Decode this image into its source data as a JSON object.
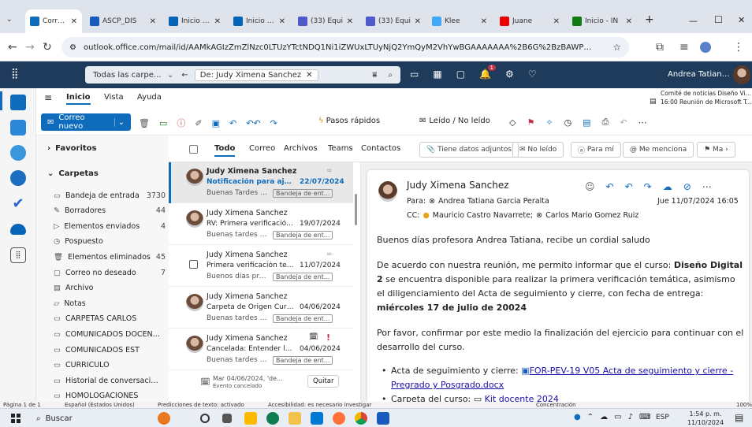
{
  "browser": {
    "tabs": [
      {
        "label": "Correo: Ai",
        "active": true,
        "color": "#0f6cbd"
      },
      {
        "label": "ASCP_DIS",
        "color": "#185abd"
      },
      {
        "label": "Inicio - O",
        "color": "#0364b8"
      },
      {
        "label": "Inicio - O",
        "color": "#0364b8"
      },
      {
        "label": "(33) Equi",
        "color": "#5059c9"
      },
      {
        "label": "(33) Equi",
        "color": "#5059c9"
      },
      {
        "label": "Klee",
        "color": "#3fa9f5"
      },
      {
        "label": "Juane",
        "color": "#e00"
      },
      {
        "label": "Inicio - IN",
        "color": "#107c10"
      }
    ],
    "new_tab": "+",
    "minimize": "—",
    "maximize": "☐",
    "close": "✕",
    "url": "outlook.office.com/mail/id/AAMkAGIzZmZlNzc0LTUzYTctNDQ1Ni1iZWUxLTUyNjQ2YmQyM2VhYwBGAAAAAAA%2B6G%2BzBAWPSKhEFeCziPrkBwC2ZD24..."
  },
  "outlook": {
    "search_scope": "Todas las carpe...",
    "search_chip": "De: Judy Ximena Sanchez",
    "user_name": "Andrea Tatiana Ga...",
    "notif_count": "1"
  },
  "ribbon": {
    "tabs": [
      "Inicio",
      "Vista",
      "Ayuda"
    ],
    "new_mail": "Correo nuevo",
    "quick_steps": "Pasos rápidos",
    "read_unread": "Leído / No leído",
    "reminder_title": "Comité de noticias Diseño Vis...",
    "reminder_time": "16:00 Reunión de Microsoft Tea..."
  },
  "folders": {
    "favorites": "Favoritos",
    "folders_header": "Carpetas",
    "items": [
      {
        "label": "Bandeja de entrada",
        "count": "3730"
      },
      {
        "label": "Borradores",
        "count": "44"
      },
      {
        "label": "Elementos enviados",
        "count": "4"
      },
      {
        "label": "Pospuesto",
        "count": ""
      },
      {
        "label": "Elementos eliminados",
        "count": "45"
      },
      {
        "label": "Correo no deseado",
        "count": "7"
      },
      {
        "label": "Archivo",
        "count": ""
      },
      {
        "label": "Notas",
        "count": ""
      },
      {
        "label": "CARPETAS CARLOS",
        "count": ""
      },
      {
        "label": "COMUNICADOS DOCENTES",
        "count": ""
      },
      {
        "label": "COMUNICADOS EST",
        "count": ""
      },
      {
        "label": "CURRICULO",
        "count": ""
      },
      {
        "label": "Historial de conversaciones",
        "count": ""
      },
      {
        "label": "HOMOLOGACIONES",
        "count": ""
      }
    ]
  },
  "filters": {
    "tabs": [
      "Todo",
      "Correo",
      "Archivos",
      "Teams",
      "Contactos"
    ],
    "buttons": [
      "Tiene datos adjuntos",
      "No leído",
      "Para mí",
      "Me menciona",
      "Ma"
    ]
  },
  "messages": [
    {
      "sender": "Judy Ximena Sanchez",
      "subject": "Notificación para ajuste...",
      "date": "22/07/2024",
      "preview": "Buenas Tardes Pr...",
      "folder": "Bandeja de ent..."
    },
    {
      "sender": "Judy Ximena Sanchez",
      "subject": "RV: Primera verificación t...",
      "date": "19/07/2024",
      "preview": "Buenas tardes pr...",
      "folder": "Bandeja de ent..."
    },
    {
      "sender": "Judy Ximena Sanchez",
      "subject": "Primera verificación temá...",
      "date": "11/07/2024",
      "preview": "Buenos días profe...",
      "folder": "Bandeja de ent..."
    },
    {
      "sender": "Judy Ximena Sanchez",
      "subject": "Carpeta de Origen Curso:...",
      "date": "04/06/2024",
      "preview": "Buenas tardes Ma...",
      "folder": "Bandeja de ent..."
    },
    {
      "sender": "Judy Ximena Sanchez",
      "subject": "Cancelada: Entender las ...",
      "date": "04/06/2024",
      "preview": "Buenas tardes Ma...",
      "folder": "Bandeja de ent..."
    }
  ],
  "event": {
    "date": "Mar 04/06/2024, 'de...",
    "status": "Evento cancelado",
    "remove": "Quitar"
  },
  "reading": {
    "sender": "Judy Ximena Sanchez",
    "to_label": "Para:",
    "to": "Andrea Tatiana Garcia Peralta",
    "cc_label": "CC:",
    "cc1": "Mauricio Castro Navarrete;",
    "cc2": "Carlos Mario Gomez Ruiz",
    "date": "Jue 11/07/2024 16:05",
    "greeting": "Buenos días profesora Andrea Tatiana, recibe un cordial saludo",
    "p2_a": "De acuerdo con nuestra reunión, me permito informar que el curso: ",
    "p2_b": "Diseño Digital 2",
    "p2_c": " se encuentra disponible para realizar la primera verificación temática, asimismo el diligenciamiento del Acta de seguimiento y cierre, con fecha de entrega: ",
    "p2_d": "miércoles 17 de julio de 20024",
    "p3": "Por favor, confirmar por este medio la finalización del ejercicio para continuar con el desarrollo del curso.",
    "bullet1_label": "Acta de seguimiento y cierre: ",
    "bullet1_link": "FOR-PEV-19 V05 Acta de seguimiento y cierre - Pregrado y Posgrado.docx",
    "bullet2_label": "Carpeta del curso:",
    "bullet2_link": "Kit docente 2024"
  },
  "status": {
    "page": "Página 1 de 1",
    "language": "Español (Estados Unidos)",
    "predictions": "Predicciones de texto: activado",
    "accessibility": "Accesibilidad: es necesario investigar",
    "focus": "Concentración",
    "zoom": "100%"
  },
  "taskbar": {
    "search": "Buscar",
    "lang": "ESP",
    "time": "1:54 p. m.",
    "date": "11/10/2024"
  }
}
